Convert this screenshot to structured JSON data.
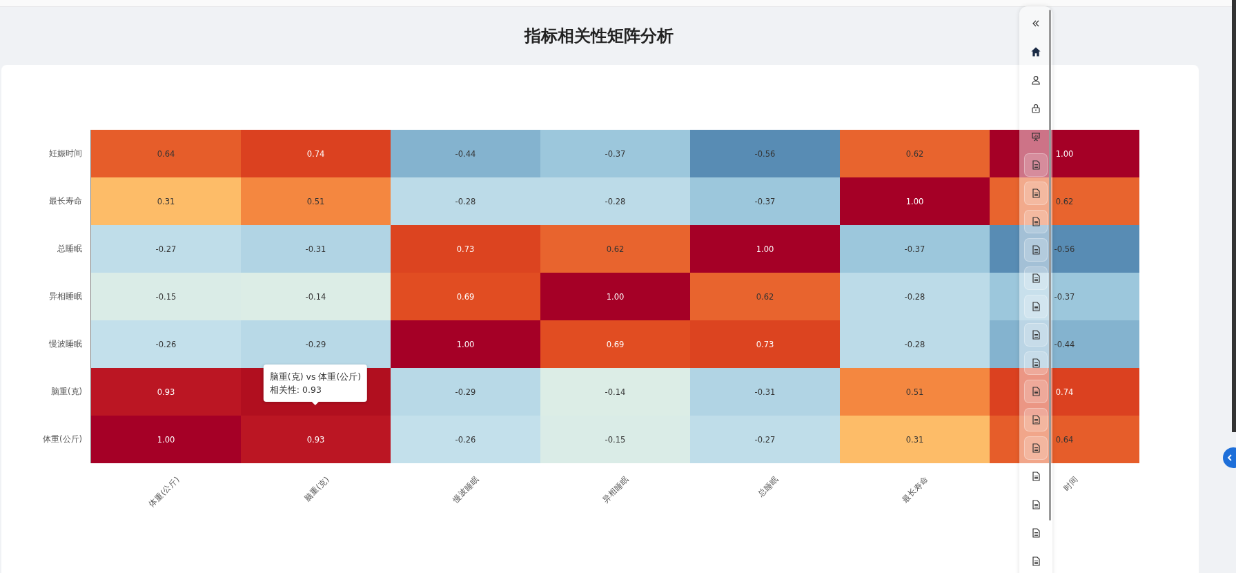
{
  "title": "指标相关性矩阵分析",
  "heatmap": {
    "matrix": [
      {
        "label": "妊娠时间",
        "cells": [
          "0.64",
          "0.74",
          "-0.44",
          "-0.37",
          "-0.56",
          "0.62",
          "1.00"
        ]
      },
      {
        "label": "最长寿命",
        "cells": [
          "0.31",
          "0.51",
          "-0.28",
          "-0.28",
          "-0.37",
          "1.00",
          "0.62"
        ]
      },
      {
        "label": "总睡眠",
        "cells": [
          "-0.27",
          "-0.31",
          "0.73",
          "0.62",
          "1.00",
          "-0.37",
          "-0.56"
        ]
      },
      {
        "label": "异相睡眠",
        "cells": [
          "-0.15",
          "-0.14",
          "0.69",
          "1.00",
          "0.62",
          "-0.28",
          "-0.37"
        ]
      },
      {
        "label": "慢波睡眠",
        "cells": [
          "-0.26",
          "-0.29",
          "1.00",
          "0.69",
          "0.73",
          "-0.28",
          "-0.44"
        ]
      },
      {
        "label": "脑重(克)",
        "cells": [
          "0.93",
          {
            "color": "#b10f1f"
          },
          "-0.29",
          "-0.14",
          "-0.31",
          "0.51",
          "0.74"
        ]
      },
      {
        "label": "体重(公斤)",
        "cells": [
          "1.00",
          "0.93",
          "-0.26",
          "-0.15",
          "-0.27",
          "0.31",
          "0.64"
        ]
      }
    ],
    "x_axis_labels": [
      "体重(公斤)",
      "脑重(克)",
      "慢波睡眠",
      "异相睡眠",
      "总睡眠",
      "最长寿命",
      "时间"
    ],
    "tooltip": {
      "title": "脑重(克) vs 体重(公斤)",
      "text": "相关性: 0.93"
    }
  },
  "nav": [
    {
      "kind": "collapse",
      "selected": false
    },
    {
      "kind": "home",
      "selected": true
    },
    {
      "kind": "user",
      "selected": false
    },
    {
      "kind": "lock",
      "selected": false
    },
    {
      "kind": "presentation",
      "selected": false
    },
    {
      "kind": "document",
      "selected": false
    },
    {
      "kind": "document",
      "selected": false
    },
    {
      "kind": "document",
      "selected": false
    },
    {
      "kind": "document",
      "selected": false
    },
    {
      "kind": "document",
      "selected": false
    },
    {
      "kind": "document",
      "selected": false
    },
    {
      "kind": "document",
      "selected": false
    },
    {
      "kind": "document",
      "selected": false
    },
    {
      "kind": "document",
      "selected": false
    },
    {
      "kind": "document",
      "selected": false
    },
    {
      "kind": "document",
      "selected": false
    },
    {
      "kind": "document",
      "selected": false
    },
    {
      "kind": "document",
      "selected": false
    },
    {
      "kind": "document",
      "selected": false
    },
    {
      "kind": "document",
      "selected": false
    }
  ]
}
